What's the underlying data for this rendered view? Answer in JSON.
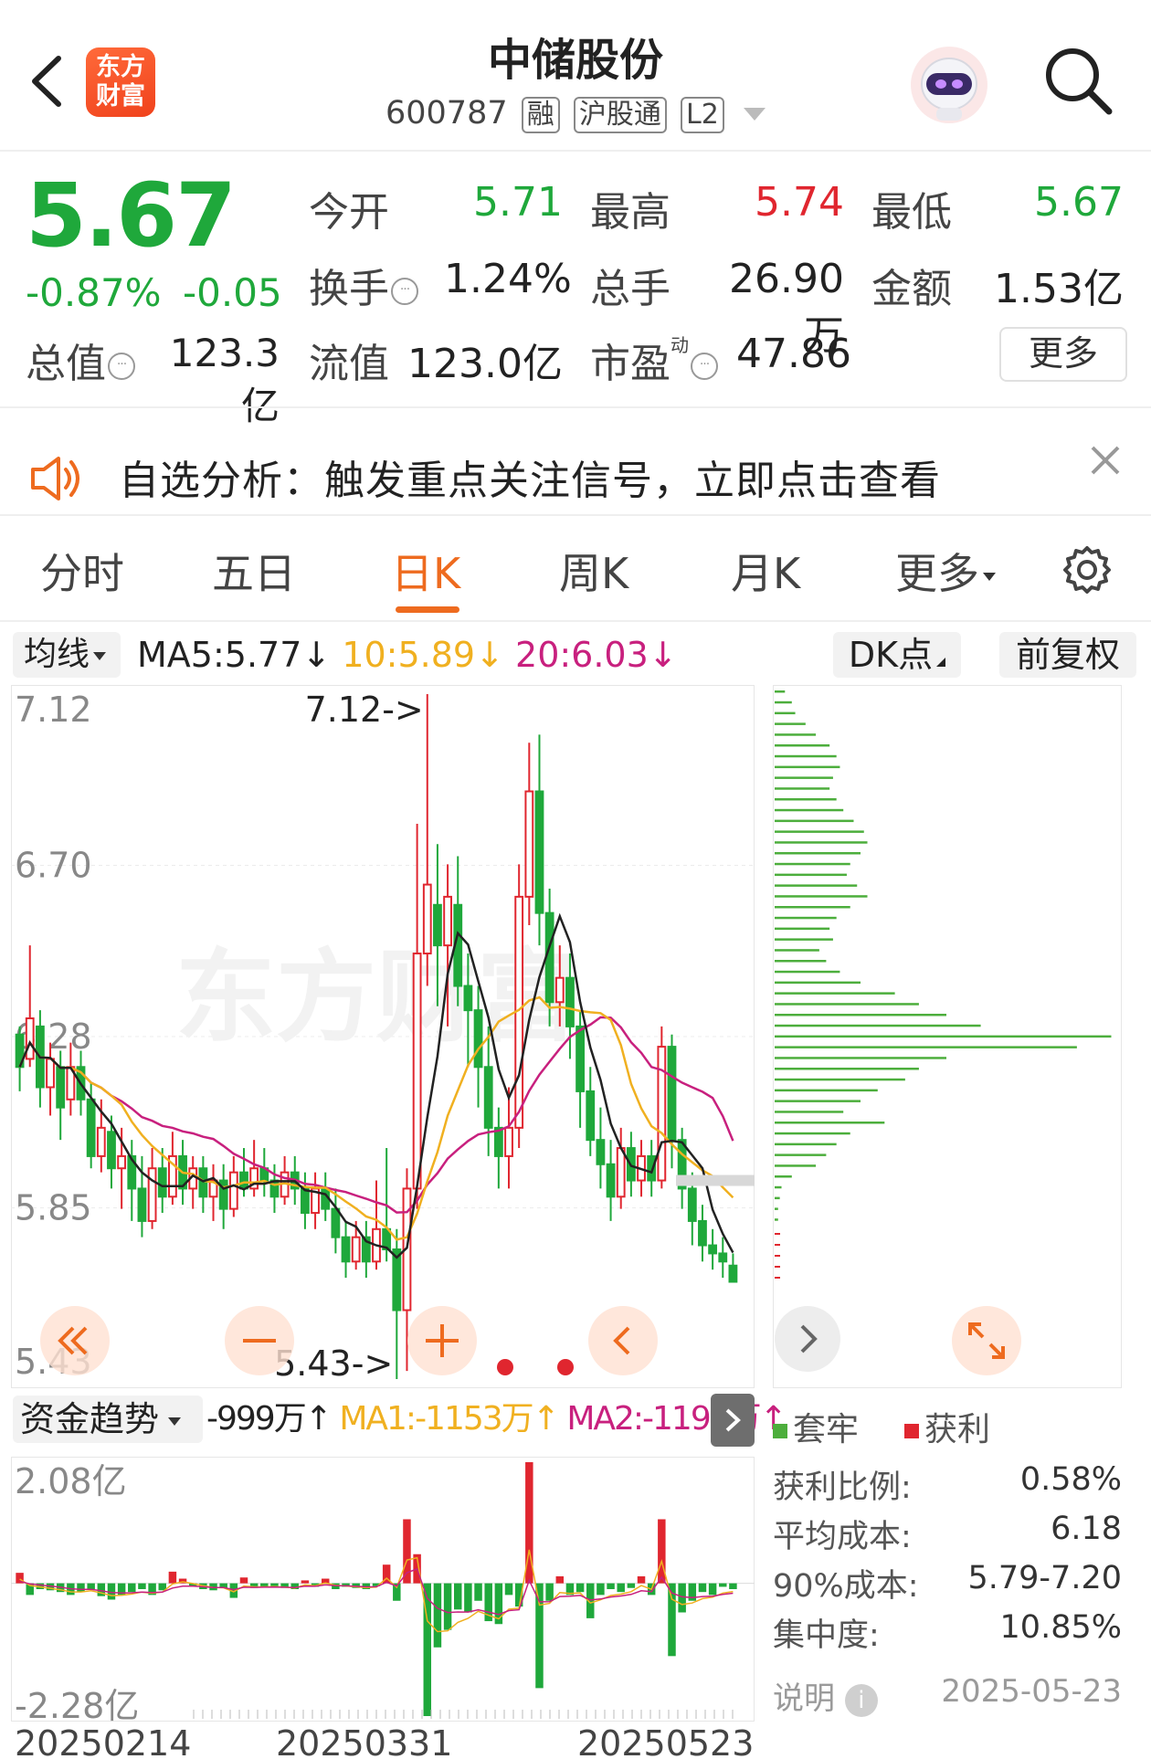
{
  "header": {
    "back_label": "返回",
    "logo_text": "东方财富",
    "stock_name": "中储股份",
    "code": "600787",
    "tags": [
      "融",
      "沪股通",
      "L2"
    ]
  },
  "quote": {
    "price": "5.67",
    "change_pct": "-0.87%",
    "change": "-0.05",
    "fields": [
      {
        "label": "今开",
        "value": "5.71",
        "color": "#1fa83b"
      },
      {
        "label": "最高",
        "value": "5.74",
        "color": "#e0262f"
      },
      {
        "label": "最低",
        "value": "5.67",
        "color": "#1fa83b"
      },
      {
        "label": "换手",
        "value": "1.24%",
        "color": "#222222"
      },
      {
        "label": "总手",
        "value": "26.90万",
        "color": "#222222"
      },
      {
        "label": "金额",
        "value": "1.53亿",
        "color": "#222222"
      },
      {
        "label": "总值",
        "value": "123.3亿",
        "color": "#222222"
      },
      {
        "label": "流值",
        "value": "123.0亿",
        "color": "#222222"
      },
      {
        "label": "市盈",
        "value": "47.86",
        "color": "#222222"
      }
    ],
    "pe_superscript": "动",
    "more_label": "更多"
  },
  "notice": {
    "text": "自选分析：触发重点关注信号，立即点击查看"
  },
  "tabs": [
    "分时",
    "五日",
    "日K",
    "周K",
    "月K",
    "更多"
  ],
  "active_tab": "日K",
  "ma_bar": {
    "select_label": "均线",
    "ma5": "MA5:5.77",
    "ma10": "10:5.89",
    "ma20": "20:6.03",
    "arrow": "↓",
    "dk_label": "DK点",
    "adjust_label": "前复权",
    "colors": {
      "ma5": "#222222",
      "ma10": "#f0b020",
      "ma20": "#c8207e"
    }
  },
  "chart_data": [
    {
      "type": "candlestick",
      "title": "日K",
      "y_ticks": [
        "7.12",
        "6.70",
        "6.28",
        "5.85",
        "5.43"
      ],
      "ylim": [
        5.43,
        7.12
      ],
      "max_label": "7.12->",
      "min_label": "5.43->",
      "x_tick_labels": [
        "20250214",
        "20250331",
        "20250523"
      ],
      "watermark": "东方财富",
      "colors": {
        "up": "#e0262f",
        "down": "#1fa83b"
      },
      "candles": [
        [
          6.28,
          6.2,
          6.3,
          6.14
        ],
        [
          6.22,
          6.32,
          6.5,
          6.2
        ],
        [
          6.3,
          6.15,
          6.34,
          6.1
        ],
        [
          6.15,
          6.22,
          6.26,
          6.08
        ],
        [
          6.2,
          6.1,
          6.24,
          6.02
        ],
        [
          6.12,
          6.2,
          6.26,
          6.08
        ],
        [
          6.2,
          6.12,
          6.24,
          6.08
        ],
        [
          6.12,
          5.98,
          6.16,
          5.95
        ],
        [
          5.98,
          6.05,
          6.12,
          5.94
        ],
        [
          6.04,
          5.95,
          6.08,
          5.9
        ],
        [
          5.95,
          5.98,
          6.05,
          5.85
        ],
        [
          5.98,
          5.9,
          6.02,
          5.82
        ],
        [
          5.9,
          5.82,
          5.98,
          5.78
        ],
        [
          5.82,
          5.95,
          6.0,
          5.8
        ],
        [
          5.95,
          5.88,
          6.0,
          5.84
        ],
        [
          5.88,
          5.98,
          6.04,
          5.86
        ],
        [
          5.98,
          5.9,
          6.02,
          5.86
        ],
        [
          5.9,
          5.95,
          5.98,
          5.85
        ],
        [
          5.95,
          5.88,
          5.98,
          5.84
        ],
        [
          5.88,
          5.92,
          5.96,
          5.82
        ],
        [
          5.92,
          5.85,
          5.96,
          5.8
        ],
        [
          5.85,
          5.94,
          5.98,
          5.83
        ],
        [
          5.94,
          5.9,
          6.0,
          5.88
        ],
        [
          5.9,
          5.95,
          6.02,
          5.88
        ],
        [
          5.95,
          5.92,
          6.0,
          5.88
        ],
        [
          5.92,
          5.88,
          5.96,
          5.84
        ],
        [
          5.88,
          5.94,
          5.98,
          5.86
        ],
        [
          5.94,
          5.9,
          5.98,
          5.86
        ],
        [
          5.9,
          5.84,
          5.94,
          5.8
        ],
        [
          5.84,
          5.9,
          5.94,
          5.8
        ],
        [
          5.9,
          5.85,
          5.94,
          5.82
        ],
        [
          5.85,
          5.78,
          5.9,
          5.74
        ],
        [
          5.78,
          5.72,
          5.82,
          5.68
        ],
        [
          5.72,
          5.78,
          5.82,
          5.7
        ],
        [
          5.78,
          5.72,
          5.82,
          5.68
        ],
        [
          5.72,
          5.8,
          5.92,
          5.7
        ],
        [
          5.8,
          5.75,
          6.0,
          5.72
        ],
        [
          5.75,
          5.6,
          5.8,
          5.43
        ],
        [
          5.6,
          5.9,
          5.95,
          5.45
        ],
        [
          5.9,
          6.48,
          6.8,
          5.85
        ],
        [
          6.48,
          6.65,
          7.12,
          6.4
        ],
        [
          6.6,
          6.5,
          6.75,
          6.35
        ],
        [
          6.5,
          6.62,
          6.7,
          6.3
        ],
        [
          6.6,
          6.4,
          6.72,
          6.35
        ],
        [
          6.4,
          6.34,
          6.48,
          6.2
        ],
        [
          6.34,
          6.2,
          6.4,
          6.1
        ],
        [
          6.2,
          6.05,
          6.3,
          5.98
        ],
        [
          6.05,
          5.98,
          6.1,
          5.9
        ],
        [
          5.98,
          6.05,
          6.15,
          5.9
        ],
        [
          6.05,
          6.62,
          6.7,
          6.0
        ],
        [
          6.62,
          6.88,
          7.0,
          6.55
        ],
        [
          6.88,
          6.58,
          7.02,
          6.5
        ],
        [
          6.58,
          6.36,
          6.64,
          6.3
        ],
        [
          6.36,
          6.42,
          6.5,
          6.3
        ],
        [
          6.42,
          6.3,
          6.48,
          6.22
        ],
        [
          6.3,
          6.14,
          6.34,
          6.05
        ],
        [
          6.14,
          6.02,
          6.2,
          5.98
        ],
        [
          6.02,
          5.96,
          6.1,
          5.9
        ],
        [
          5.96,
          5.88,
          6.02,
          5.82
        ],
        [
          5.88,
          6.0,
          6.05,
          5.85
        ],
        [
          6.0,
          5.92,
          6.04,
          5.88
        ],
        [
          5.92,
          5.98,
          6.02,
          5.88
        ],
        [
          5.98,
          5.92,
          6.02,
          5.88
        ],
        [
          5.92,
          6.25,
          6.3,
          5.9
        ],
        [
          6.25,
          6.02,
          6.28,
          5.95
        ],
        [
          6.02,
          5.9,
          6.05,
          5.85
        ],
        [
          5.9,
          5.82,
          5.94,
          5.76
        ],
        [
          5.82,
          5.76,
          5.86,
          5.72
        ],
        [
          5.76,
          5.74,
          5.8,
          5.7
        ],
        [
          5.74,
          5.72,
          5.78,
          5.68
        ],
        [
          5.71,
          5.67,
          5.74,
          5.67
        ]
      ]
    },
    {
      "type": "bar",
      "title": "资金趋势",
      "y_ticks": [
        "2.08亿",
        "-2.28亿"
      ],
      "ylim": [
        -2.28,
        2.08
      ],
      "value_unit": "亿",
      "colors": {
        "positive": "#e0262f",
        "negative": "#1fa83b"
      },
      "values": [
        0.18,
        -0.2,
        -0.1,
        -0.12,
        -0.15,
        -0.2,
        -0.15,
        -0.1,
        -0.22,
        -0.28,
        -0.2,
        -0.15,
        -0.1,
        -0.2,
        -0.12,
        0.2,
        0.08,
        -0.05,
        -0.1,
        -0.12,
        -0.08,
        -0.25,
        0.1,
        -0.08,
        -0.06,
        -0.05,
        -0.08,
        -0.1,
        0.05,
        -0.06,
        0.08,
        -0.1,
        -0.06,
        -0.08,
        -0.1,
        -0.05,
        0.32,
        -0.3,
        1.1,
        0.5,
        -2.28,
        -1.1,
        -0.8,
        -0.45,
        -0.5,
        -0.3,
        -0.65,
        -0.7,
        -0.2,
        -0.4,
        2.08,
        -1.8,
        -0.3,
        0.12,
        -0.2,
        -0.15,
        -0.6,
        -0.2,
        -0.1,
        -0.15,
        -0.08,
        0.12,
        -0.2,
        1.1,
        -1.25,
        -0.5,
        -0.3,
        -0.15,
        -0.2,
        -0.06,
        -0.1
      ]
    },
    {
      "type": "bar",
      "title": "筹码分布",
      "orientation": "horizontal",
      "legend": [
        "套牢",
        "获利"
      ],
      "colors": {
        "trapped": "#4cae3c",
        "profit": "#e0262f"
      },
      "values": [
        0.03,
        0.05,
        0.06,
        0.09,
        0.12,
        0.16,
        0.18,
        0.19,
        0.17,
        0.16,
        0.18,
        0.2,
        0.23,
        0.26,
        0.27,
        0.25,
        0.22,
        0.21,
        0.24,
        0.27,
        0.22,
        0.18,
        0.16,
        0.17,
        0.13,
        0.15,
        0.19,
        0.25,
        0.35,
        0.42,
        0.5,
        0.6,
        0.98,
        0.88,
        0.5,
        0.42,
        0.38,
        0.3,
        0.25,
        0.2,
        0.32,
        0.22,
        0.18,
        0.15,
        0.12,
        0.05,
        0.02,
        0.015,
        0.01,
        0.01
      ]
    }
  ],
  "kline_controls": {
    "rewind_icon": "double-chevron-left-icon",
    "zoom_out_icon": "minus-icon",
    "zoom_in_icon": "plus-icon",
    "prev_icon": "chevron-left-icon",
    "next_icon": "chevron-right-icon",
    "expand_icon": "expand-arrows-icon"
  },
  "flow_bar": {
    "select_label": "资金趋势",
    "value": "-999万",
    "ma1": "MA1:-1153万",
    "ma2": "MA2:-1195万",
    "arrow": "↑"
  },
  "chip_stats": {
    "legend_trapped": "套牢",
    "legend_profit": "获利",
    "rows": [
      {
        "label": "获利比例:",
        "value": "0.58%"
      },
      {
        "label": "平均成本:",
        "value": "6.18"
      },
      {
        "label": "90%成本:",
        "value": "5.79-7.20"
      },
      {
        "label": "集中度:",
        "value": "10.85%"
      }
    ],
    "note_label": "说明",
    "date": "2025-05-23"
  }
}
